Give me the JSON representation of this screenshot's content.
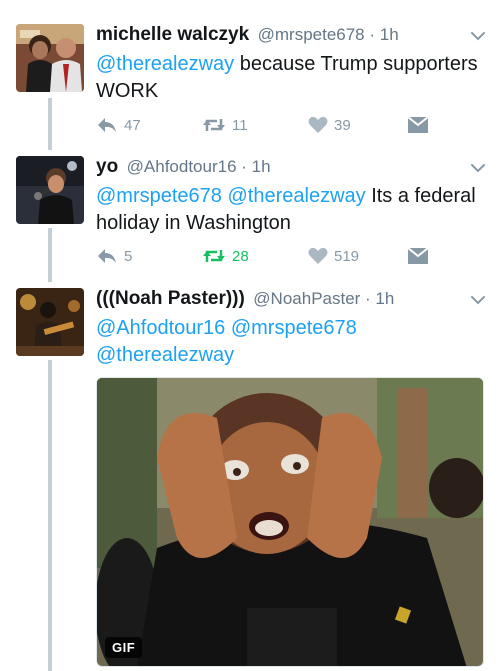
{
  "tweets": [
    {
      "name": "michelle walczyk",
      "meta": "@mrspete678 · 1h",
      "text_mention": "@therealezway",
      "text_rest": " because Trump supporters WORK",
      "reply_count": "47",
      "retweet_count": "11",
      "like_count": "39"
    },
    {
      "name": "yo",
      "meta": "@Ahfodtour16 · 1h",
      "mention_1": "@mrspete678",
      "mention_2": "@therealezway",
      "text_rest": " Its a federal holiday in Washington",
      "reply_count": "5",
      "retweet_count": "28",
      "like_count": "519",
      "retweeted": true
    },
    {
      "name": "(((Noah Paster)))",
      "meta": "@NoahPaster · 1h",
      "mention_1": "@Ahfodtour16",
      "mention_2": "@mrspete678",
      "mention_3": "@therealezway",
      "media_badge": "GIF"
    }
  ],
  "colors": {
    "link": "#1da1f2",
    "icon_gray": "#8899a6",
    "retweet_active": "#17bf63",
    "thread_line": "#c4cfd6"
  },
  "icons": [
    "reply-icon",
    "retweet-icon",
    "heart-icon",
    "direct-message-icon",
    "chevron-down-icon"
  ]
}
